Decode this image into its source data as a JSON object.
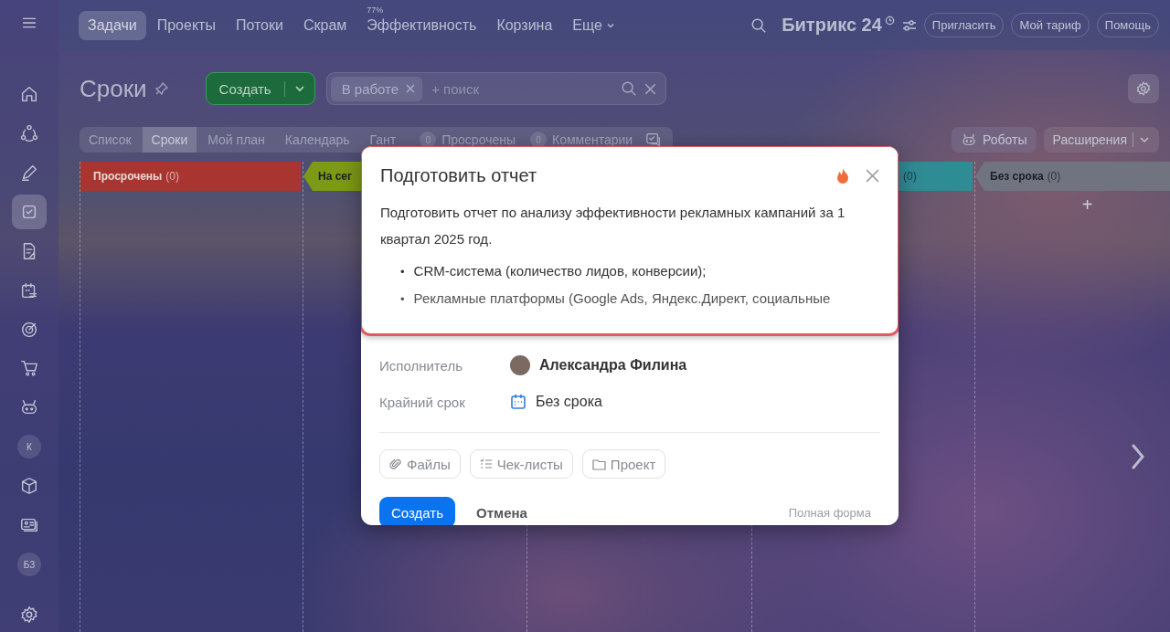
{
  "sidebar": {
    "items": [
      {
        "kind": "icon",
        "selected": false
      },
      {
        "kind": "icon",
        "selected": false
      },
      {
        "kind": "icon",
        "selected": false
      },
      {
        "kind": "icon",
        "selected": false
      },
      {
        "kind": "icon",
        "selected": true
      },
      {
        "kind": "icon",
        "selected": false
      },
      {
        "kind": "icon",
        "selected": false
      },
      {
        "kind": "icon",
        "selected": false
      },
      {
        "kind": "icon",
        "selected": false
      },
      {
        "kind": "icon",
        "selected": false
      },
      {
        "kind": "letter",
        "label": "К",
        "selected": false
      },
      {
        "kind": "icon",
        "selected": false
      },
      {
        "kind": "icon",
        "selected": false
      },
      {
        "kind": "letter",
        "label": "БЗ",
        "selected": false
      },
      {
        "kind": "icon",
        "selected": false
      }
    ]
  },
  "top_nav": {
    "tabs": [
      {
        "label": "Задачи",
        "selected": true,
        "kind": "link"
      },
      {
        "label": "Проекты",
        "selected": false,
        "kind": "link"
      },
      {
        "label": "Потоки",
        "selected": false,
        "kind": "link"
      },
      {
        "label": "Скрам",
        "selected": false,
        "kind": "link"
      },
      {
        "label": "Эффективность",
        "selected": false,
        "kind": "link",
        "badge": "77%"
      },
      {
        "label": "Корзина",
        "selected": false,
        "kind": "link"
      },
      {
        "label": "Еще",
        "selected": false,
        "kind": "menu"
      }
    ],
    "logo": "Битрикс 24",
    "buttons": [
      "Пригласить",
      "Мой тариф",
      "Помощь"
    ]
  },
  "page": {
    "title": "Сроки",
    "create_button": "Создать",
    "filter": {
      "chip": "В работе",
      "placeholder": "+ поиск"
    }
  },
  "view_tabs": [
    {
      "label": "Список",
      "selected": false
    },
    {
      "label": "Сроки",
      "selected": true
    },
    {
      "label": "Мой план",
      "selected": false
    },
    {
      "label": "Календарь",
      "selected": false
    },
    {
      "label": "Гант",
      "selected": false
    }
  ],
  "counters": [
    {
      "count": "0",
      "label": "Просрочены"
    },
    {
      "count": "0",
      "label": "Комментарии"
    }
  ],
  "toolbar_buttons": [
    "Роботы",
    "Расширения"
  ],
  "columns": [
    {
      "title": "Просрочены",
      "count": "(0)",
      "color": "#a8352f"
    },
    {
      "title": "На сег",
      "color": "#7d9a16"
    },
    {
      "count": "(0)",
      "color": "#2e8c95"
    },
    {
      "title": "Без срока",
      "count": "(0)",
      "color": "#6f7480",
      "add": "+"
    }
  ],
  "popup": {
    "title": "Подготовить отчет",
    "important": true,
    "description": "Подготовить отчет по анализу эффективности рекламных кампаний за 1 квартал 2025 год.",
    "bullet_marker": "•",
    "bullets": [
      "CRM-система (количество лидов, конверсии);",
      "Рекламные платформы (Google Ads, Яндекс.Директ, социальные"
    ],
    "fields": [
      {
        "label": "Исполнитель",
        "value": "Александра Филина",
        "kind": "person"
      },
      {
        "label": "Крайний срок",
        "value": "Без срока",
        "kind": "date"
      }
    ],
    "chips": [
      {
        "label": "Файлы",
        "kind": "files"
      },
      {
        "label": "Чек-листы",
        "kind": "checklist"
      },
      {
        "label": "Проект",
        "kind": "project"
      }
    ],
    "submit": "Создать",
    "cancel": "Отмена",
    "full_form": "Полная форма"
  }
}
